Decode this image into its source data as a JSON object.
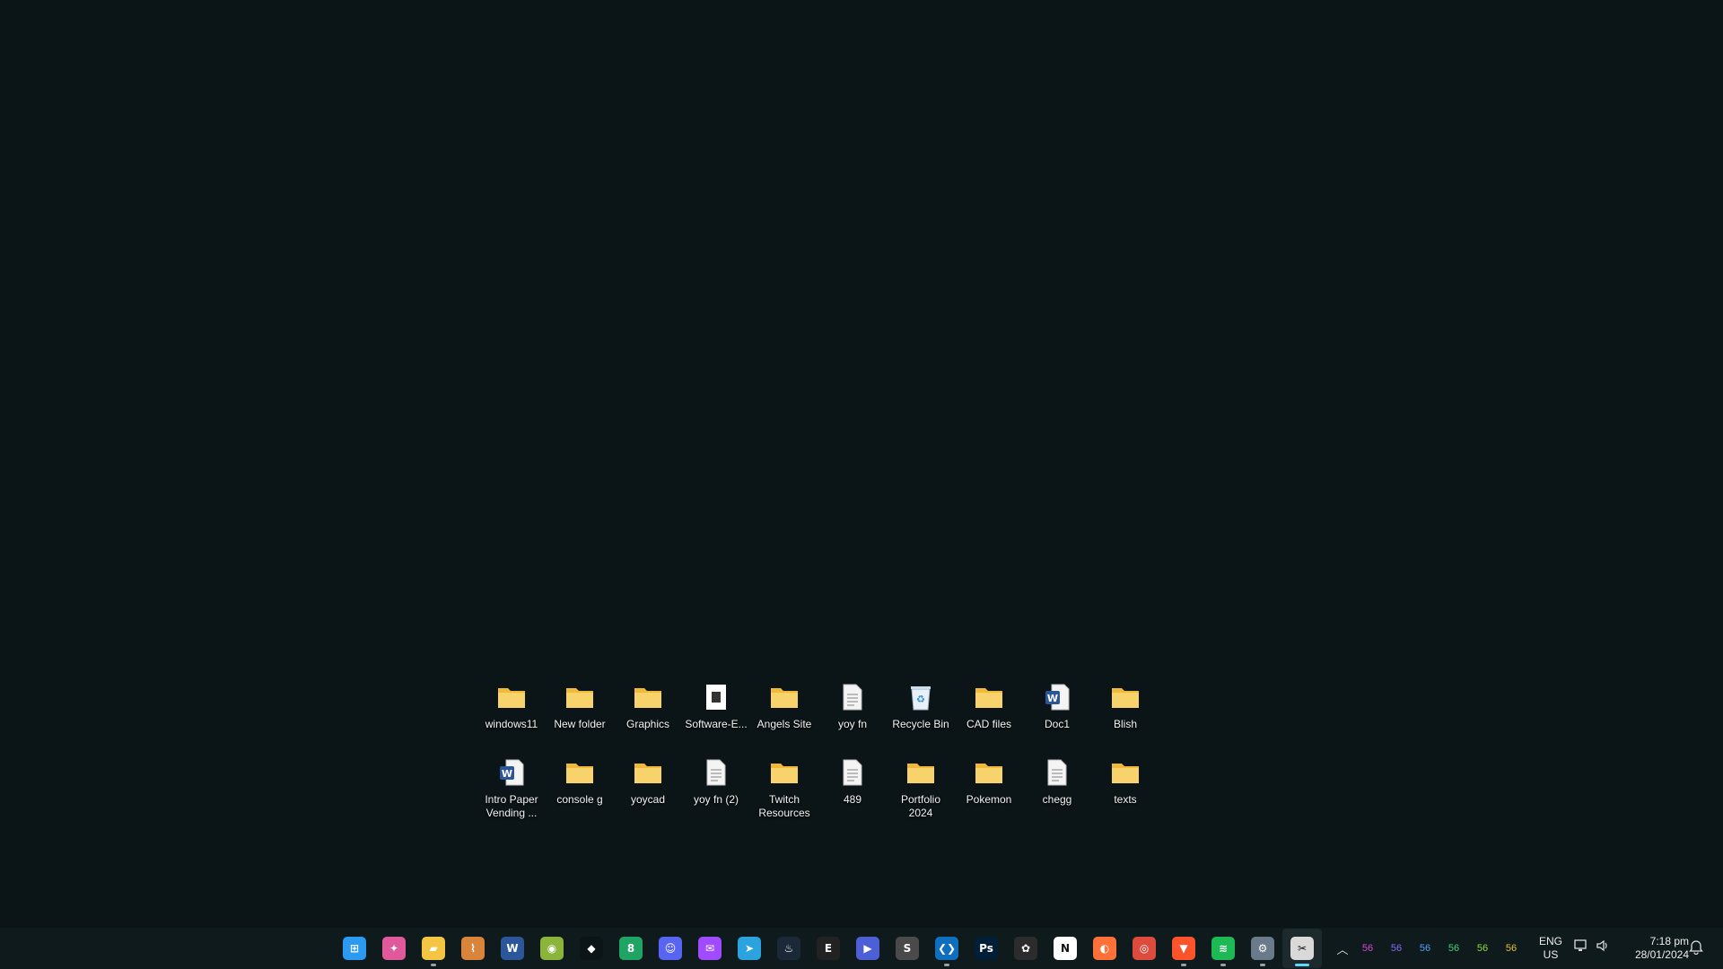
{
  "desktop": {
    "icons": [
      {
        "label": "windows11",
        "icon": "folder-icon"
      },
      {
        "label": "New folder",
        "icon": "folder-icon"
      },
      {
        "label": "Graphics",
        "icon": "folder-icon"
      },
      {
        "label": "Software-E...",
        "icon": "document-image-icon"
      },
      {
        "label": "Angels Site",
        "icon": "folder-icon"
      },
      {
        "label": "yoy fn",
        "icon": "text-file-icon"
      },
      {
        "label": "Recycle Bin",
        "icon": "recycle-bin-icon"
      },
      {
        "label": "CAD files",
        "icon": "folder-icon"
      },
      {
        "label": "Doc1",
        "icon": "word-doc-icon"
      },
      {
        "label": "Blish",
        "icon": "folder-icon"
      },
      {
        "label": "Intro Paper Vending ...",
        "icon": "word-doc-icon"
      },
      {
        "label": "console g",
        "icon": "folder-icon"
      },
      {
        "label": "yoycad",
        "icon": "folder-icon"
      },
      {
        "label": "yoy fn (2)",
        "icon": "text-file-icon"
      },
      {
        "label": "Twitch Resources",
        "icon": "folder-icon"
      },
      {
        "label": "489",
        "icon": "text-file-icon"
      },
      {
        "label": "Portfolio 2024",
        "icon": "folder-icon"
      },
      {
        "label": "Pokemon",
        "icon": "folder-icon"
      },
      {
        "label": "chegg",
        "icon": "text-file-icon"
      },
      {
        "label": "texts",
        "icon": "folder-icon"
      }
    ]
  },
  "taskbar": {
    "apps": [
      {
        "name": "start-icon",
        "color": "#2b9af3",
        "glyph": "⊞",
        "running": false
      },
      {
        "name": "copilot-icon",
        "color": "#e05a9b",
        "glyph": "✦",
        "running": false
      },
      {
        "name": "file-explorer-icon",
        "color": "#f4c542",
        "glyph": "▰",
        "running": true
      },
      {
        "name": "fan-app-icon",
        "color": "#d9843b",
        "glyph": "⌇",
        "running": false
      },
      {
        "name": "word-icon",
        "color": "#2b579a",
        "glyph": "W",
        "running": false
      },
      {
        "name": "android-icon",
        "color": "#8ab43a",
        "glyph": "◉",
        "running": false
      },
      {
        "name": "binance-icon",
        "color": "#0b1416",
        "glyph": "◆",
        "running": false
      },
      {
        "name": "eight-icon",
        "color": "#1fa463",
        "glyph": "8",
        "running": false
      },
      {
        "name": "discord-icon",
        "color": "#5865f2",
        "glyph": "☺",
        "running": false
      },
      {
        "name": "messenger-icon",
        "color": "#a04bff",
        "glyph": "✉",
        "running": false
      },
      {
        "name": "telegram-icon",
        "color": "#2aa3df",
        "glyph": "➤",
        "running": false
      },
      {
        "name": "steam-icon",
        "color": "#1b2838",
        "glyph": "♨",
        "running": false
      },
      {
        "name": "epic-games-icon",
        "color": "#222222",
        "glyph": "E",
        "running": false
      },
      {
        "name": "play-icon",
        "color": "#4c5fd7",
        "glyph": "▶",
        "running": false
      },
      {
        "name": "sublime-icon",
        "color": "#4a4a4a",
        "glyph": "S",
        "running": false
      },
      {
        "name": "vscode-icon",
        "color": "#0f6fbf",
        "glyph": "❮❯",
        "running": true
      },
      {
        "name": "photoshop-icon",
        "color": "#001e36",
        "glyph": "Ps",
        "running": false
      },
      {
        "name": "figma-icon",
        "color": "#2c2c2c",
        "glyph": "✿",
        "running": false
      },
      {
        "name": "notion-icon",
        "color": "#ffffff",
        "glyph": "N",
        "running": false
      },
      {
        "name": "firefox-icon",
        "color": "#ff7139",
        "glyph": "◐",
        "running": false
      },
      {
        "name": "chrome-icon",
        "color": "#dd4b3e",
        "glyph": "◎",
        "running": false
      },
      {
        "name": "brave-icon",
        "color": "#fb542b",
        "glyph": "▼",
        "running": true
      },
      {
        "name": "spotify-icon",
        "color": "#1db954",
        "glyph": "≋",
        "running": true
      },
      {
        "name": "settings-icon",
        "color": "#6b7a8a",
        "glyph": "⚙",
        "running": true
      },
      {
        "name": "snipping-tool-icon",
        "color": "#d9d9d9",
        "glyph": "✂",
        "running": true,
        "active": true
      }
    ],
    "tray_numbers": [
      {
        "value": "56",
        "color": "#d649d6"
      },
      {
        "value": "56",
        "color": "#8a6cff"
      },
      {
        "value": "56",
        "color": "#4aa3ff"
      },
      {
        "value": "56",
        "color": "#43d17a"
      },
      {
        "value": "56",
        "color": "#8fdc3a"
      },
      {
        "value": "56",
        "color": "#e8c23a"
      }
    ],
    "language_line1": "ENG",
    "language_line2": "US",
    "time": "7:18 pm",
    "date": "28/01/2024"
  }
}
